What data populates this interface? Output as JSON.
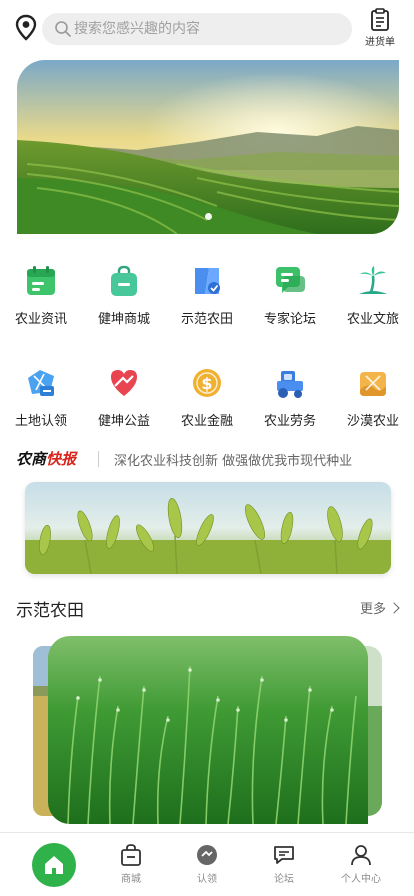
{
  "header": {
    "search_placeholder": "搜索您感兴趣的内容",
    "order_label": "进货单"
  },
  "banner": {
    "slide_count": 1,
    "active_slide": 1
  },
  "grid": {
    "row1": [
      "农业资讯",
      "健坤商城",
      "示范农田",
      "专家论坛",
      "农业文旅"
    ],
    "row2": [
      "土地认领",
      "健坤公益",
      "农业金融",
      "农业劳务",
      "沙漠农业"
    ]
  },
  "news": {
    "brand_part1": "农商",
    "brand_part2": "快报",
    "headline": "深化农业科技创新 做强做优我市现代种业"
  },
  "section": {
    "title": "示范农田",
    "more": "更多"
  },
  "tabbar": {
    "items": [
      "商城",
      "认领",
      "论坛",
      "个人中心"
    ]
  },
  "colors": {
    "accent_green": "#2fb24a",
    "brand_red": "#d9261c"
  }
}
